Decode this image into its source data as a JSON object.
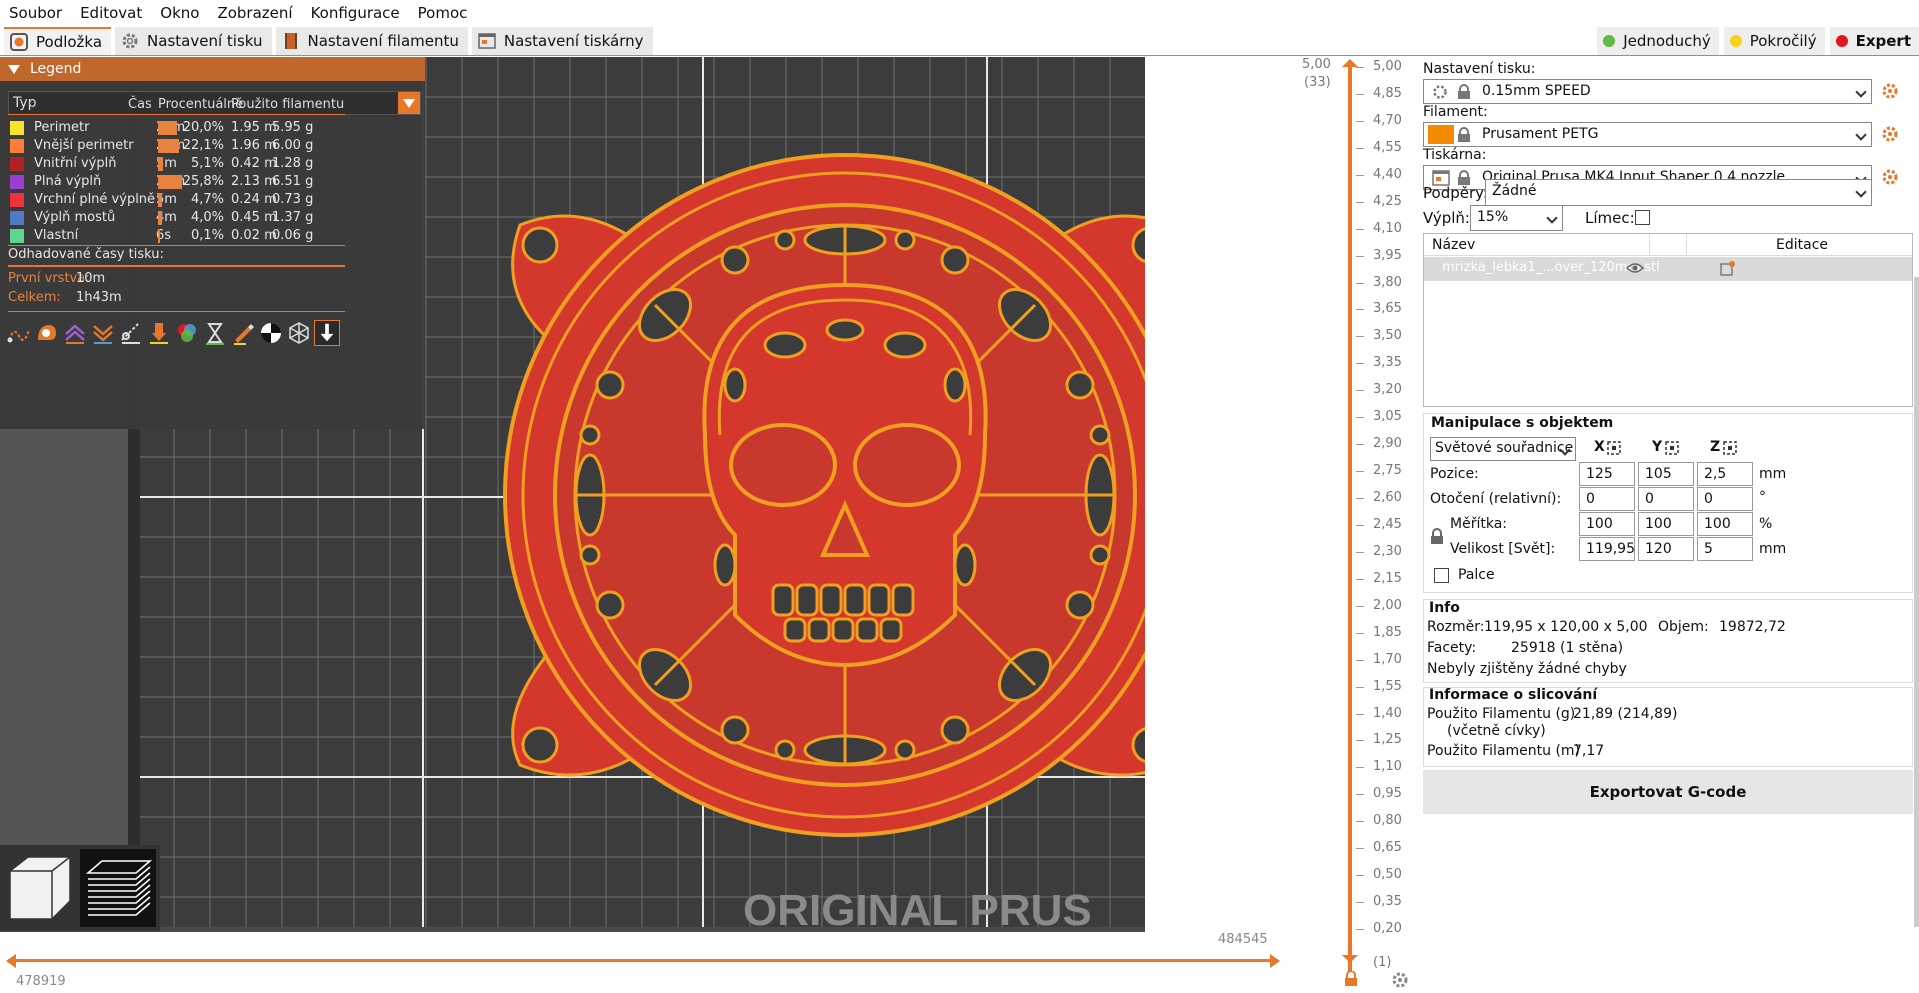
{
  "menu": [
    "Soubor",
    "Editovat",
    "Okno",
    "Zobrazení",
    "Konfigurace",
    "Pomoc"
  ],
  "tabs": [
    {
      "label": "Podložka",
      "icon": "plater-icon",
      "active": true
    },
    {
      "label": "Nastavení tisku",
      "icon": "gear-icon",
      "active": false
    },
    {
      "label": "Nastavení filamentu",
      "icon": "filament-spool-icon",
      "active": false
    },
    {
      "label": "Nastavení tiskárny",
      "icon": "printer-icon",
      "active": false
    }
  ],
  "modes": [
    {
      "label": "Jednoduchý",
      "color": "#5dbb46"
    },
    {
      "label": "Pokročilý",
      "color": "#f5d21b"
    },
    {
      "label": "Expert",
      "color": "#e4161d"
    }
  ],
  "legend": {
    "title": "Legend",
    "type_select": "Typ",
    "headers": {
      "time": "Čas",
      "percent": "Procentuálně",
      "filament": "Použito filamentu"
    },
    "rows": [
      {
        "name": "Perimetr",
        "color": "#f6e32a",
        "time": "21m",
        "bar": 0.2,
        "percent": "20,0%",
        "m": "1.95 m",
        "g": "5.95 g"
      },
      {
        "name": "Vnější perimetr",
        "color": "#ff7d38",
        "time": "23m",
        "bar": 0.221,
        "percent": "22,1%",
        "m": "1.96 m",
        "g": "6.00 g"
      },
      {
        "name": "Vnitřní výplň",
        "color": "#b02323",
        "time": "5m",
        "bar": 0.051,
        "percent": "5,1%",
        "m": "0.42 m",
        "g": "1.28 g"
      },
      {
        "name": "Plná výplň",
        "color": "#9a3fd3",
        "time": "27m",
        "bar": 0.258,
        "percent": "25,8%",
        "m": "2.13 m",
        "g": "6.51 g"
      },
      {
        "name": "Vrchní plné výplně",
        "color": "#f0323d",
        "time": "5m",
        "bar": 0.047,
        "percent": "4,7%",
        "m": "0.24 m",
        "g": "0.73 g"
      },
      {
        "name": "Výplň mostů",
        "color": "#4f7bc6",
        "time": "4m",
        "bar": 0.04,
        "percent": "4,0%",
        "m": "0.45 m",
        "g": "1.37 g"
      },
      {
        "name": "Vlastní",
        "color": "#5fd48f",
        "time": "6s",
        "bar": 0.001,
        "percent": "0,1%",
        "m": "0.02 m",
        "g": "0.06 g"
      }
    ],
    "estimated_title": "Odhadované časy tisku:",
    "first_layer_label": "První vrstva:",
    "first_layer_value": "10m",
    "total_label": "Celkem:",
    "total_value": "1h43m"
  },
  "watermark": "ORIGINAL PRUS",
  "vslider": {
    "top_value": "5,00",
    "top_layer": "(33)",
    "bottom_value": "0,20",
    "bottom_layer": "(1)",
    "labels": [
      "5,00",
      "4,85",
      "4,70",
      "4,55",
      "4,40",
      "4,25",
      "4,10",
      "3,95",
      "3,80",
      "3,65",
      "3,50",
      "3,35",
      "3,20",
      "3,05",
      "2,90",
      "2,75",
      "2,60",
      "2,45",
      "2,30",
      "2,15",
      "2,00",
      "1,85",
      "1,70",
      "1,55",
      "1,40",
      "1,25",
      "1,10",
      "0,95",
      "0,80",
      "0,65",
      "0,50",
      "0,35",
      "0,20"
    ]
  },
  "hslider": {
    "left_value": "478919",
    "right_value": "484545"
  },
  "panel": {
    "print_settings_label": "Nastavení tisku:",
    "print_settings_value": "0.15mm SPEED",
    "filament_label": "Filament:",
    "filament_value": "Prusament PETG",
    "filament_color": "#f58a00",
    "printer_label": "Tiskárna:",
    "printer_value": "Original Prusa MK4 Input Shaper 0.4 nozzle",
    "supports_label": "Podpěry:",
    "supports_value": "Žádné",
    "infill_label": "Výplň:",
    "infill_value": "15%",
    "brim_label": "Límec:",
    "list_name_header": "Název",
    "list_edit_header": "Editace",
    "object_name": "mrizka_lebka1_...over_120mm.stl",
    "manip_title": "Manipulace s objektem",
    "coord_select": "Světové souřadnice",
    "axis_x": "X",
    "axis_y": "Y",
    "axis_z": "Z",
    "position_label": "Pozice:",
    "position": [
      "125",
      "105",
      "2,5"
    ],
    "position_unit": "mm",
    "rotation_label": "Otočení (relativní):",
    "rotation": [
      "0",
      "0",
      "0"
    ],
    "rotation_unit": "°",
    "scale_label": "Měřítka:",
    "scale": [
      "100",
      "100",
      "100"
    ],
    "scale_unit": "%",
    "size_label": "Velikost [Svět]:",
    "size": [
      "119,95",
      "120",
      "5"
    ],
    "size_unit": "mm",
    "inches_label": "Palce",
    "info_title": "Info",
    "dims_label": "Rozměr:",
    "dims_value": "119,95 x 120,00 x 5,00",
    "volume_label": "Objem:",
    "volume_value": "19872,72",
    "facets_label": "Facety:",
    "facets_value": "25918 (1 stěna)",
    "no_errors": "Nebyly zjištěny žádné chyby",
    "slice_title": "Informace o slicování",
    "fil_g_label": "Použito Filamentu (g)",
    "fil_g_sub": "(včetně cívky)",
    "fil_g_value": "21,89 (214,89)",
    "fil_m_label": "Použito Filamentu (m)",
    "fil_m_value": "7,17",
    "export_label": "Exportovat G-code"
  }
}
